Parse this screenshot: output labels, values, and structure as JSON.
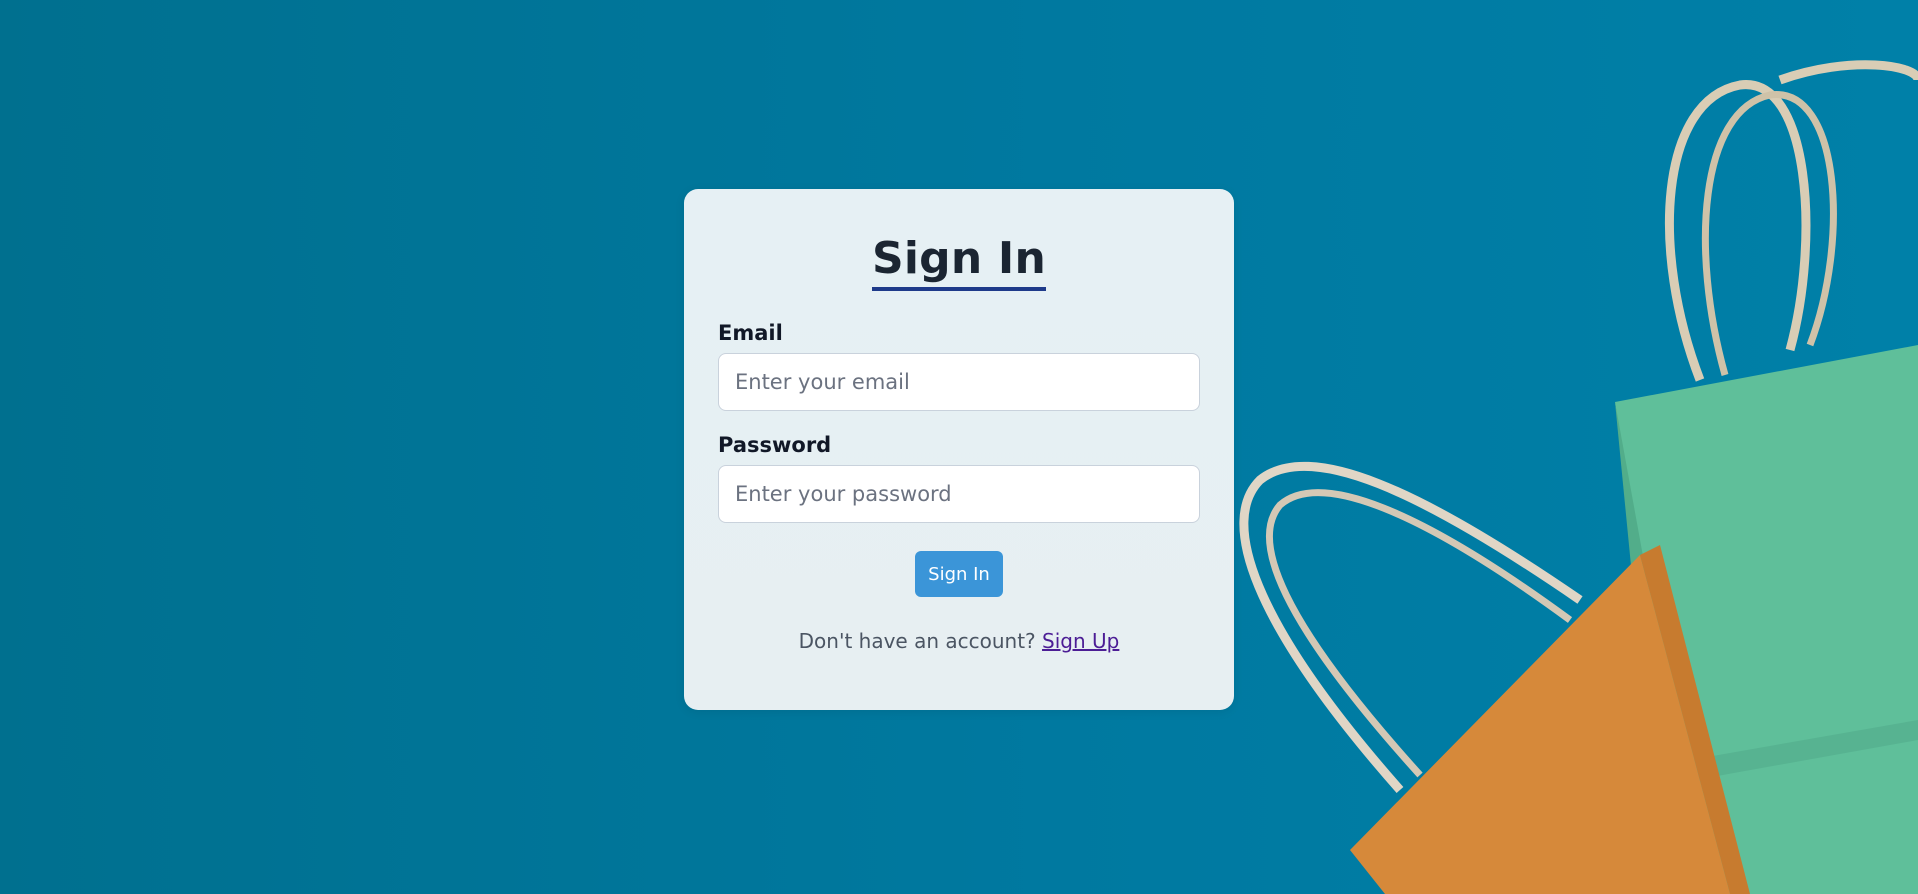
{
  "page": {
    "background_color": "#0079a0"
  },
  "card": {
    "title": "Sign In",
    "email": {
      "label": "Email",
      "placeholder": "Enter your email",
      "value": ""
    },
    "password": {
      "label": "Password",
      "placeholder": "Enter your password",
      "value": ""
    },
    "submit_label": "Sign In",
    "footer_text": "Don't have an account?",
    "signup_link": "Sign Up"
  },
  "colors": {
    "accent_underline": "#1e3a8a",
    "button": "#3b95d8",
    "link": "#4c1d95"
  }
}
